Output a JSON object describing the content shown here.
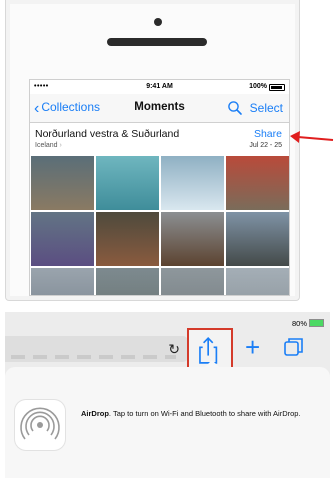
{
  "phone": {
    "status": {
      "signal": "•••••",
      "time": "9:41 AM",
      "battery": "100%"
    },
    "nav": {
      "back_label": "Collections",
      "title": "Moments",
      "select_label": "Select"
    },
    "moment": {
      "title": "Norðurland vestra & Suðurland",
      "subtitle": "Iceland",
      "share_label": "Share",
      "date": "Jul 22 - 25"
    },
    "photos": [
      {
        "name": "photo-aerial-town",
        "top": "#5a6e78",
        "bottom": "#8a7a63"
      },
      {
        "name": "photo-hot-spring",
        "top": "#6fb6bf",
        "bottom": "#3f8d9a"
      },
      {
        "name": "photo-water-slide",
        "top": "#8fb0c3",
        "bottom": "#d9e7ef"
      },
      {
        "name": "photo-woman-red-jacket",
        "top": "#b94a3a",
        "bottom": "#7a6c5a"
      },
      {
        "name": "photo-lupine-field",
        "top": "#627484",
        "bottom": "#5b4e82"
      },
      {
        "name": "photo-woman-portrait",
        "top": "#4e4a3d",
        "bottom": "#8a5b3e"
      },
      {
        "name": "photo-horse",
        "top": "#8b8f92",
        "bottom": "#5c4330"
      },
      {
        "name": "photo-road",
        "top": "#7f93a6",
        "bottom": "#444a49"
      },
      {
        "name": "photo-bottom-1",
        "top": "#9aa4ad",
        "bottom": "#7a8590"
      },
      {
        "name": "photo-bottom-2",
        "top": "#7d8a8f",
        "bottom": "#6b7574"
      },
      {
        "name": "photo-bottom-3",
        "top": "#8e979c",
        "bottom": "#777f83"
      },
      {
        "name": "photo-bottom-4",
        "top": "#a4aeb6",
        "bottom": "#8c959b"
      }
    ]
  },
  "ipad": {
    "battery": "80%",
    "airdrop": {
      "title": "AirDrop",
      "message": ". Tap to turn on Wi-Fi and Bluetooth to share with AirDrop."
    }
  },
  "colors": {
    "accent": "#1a7ef6",
    "highlight": "#d43a2a",
    "battery_green": "#4cd964"
  }
}
